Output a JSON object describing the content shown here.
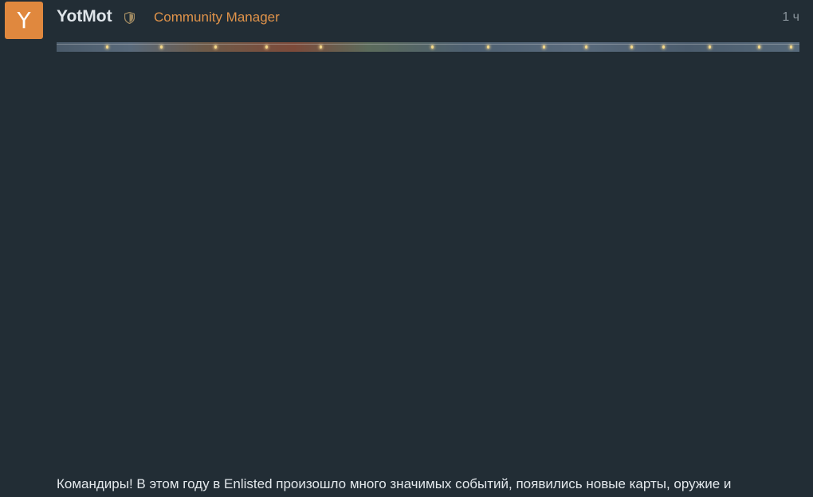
{
  "post": {
    "avatar_letter": "Y",
    "avatar_color": "#e0883e",
    "username": "YotMot",
    "badge_icon": "shield-icon",
    "user_title": "Community Manager",
    "time_ago": "1 ч",
    "image_alt": "Holiday banner with string lights",
    "body_text": "Командиры! В этом году в Enlisted произошло много значимых событий, появились новые карты, оружие и"
  },
  "colors": {
    "background": "#222d35",
    "accent": "#e0934a",
    "text": "#e3e8ec",
    "muted": "#8a949c"
  }
}
